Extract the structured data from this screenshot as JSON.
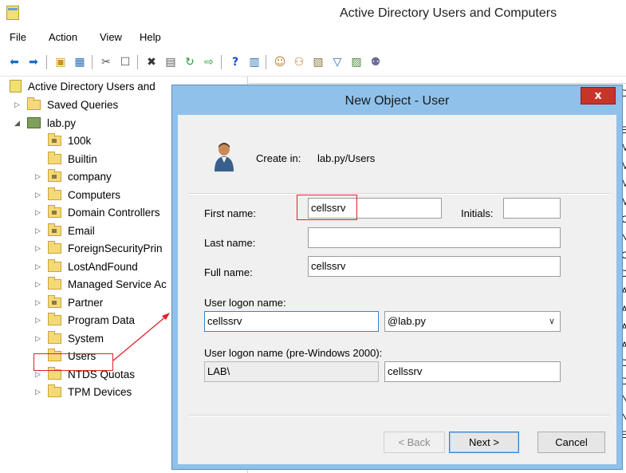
{
  "window": {
    "title": "Active Directory Users and Computers"
  },
  "menu": [
    "File",
    "Action",
    "View",
    "Help"
  ],
  "toolbar_icons": [
    "back-arrow-icon",
    "forward-arrow-icon",
    "up-folder-icon",
    "properties-icon",
    "cut-icon",
    "copy-icon",
    "delete-icon",
    "export-icon",
    "refresh-icon",
    "export-list-icon",
    "help-icon",
    "console-tree-icon",
    "new-user-icon",
    "new-group-icon",
    "new-ou-icon",
    "filter-icon",
    "find-icon",
    "delegate-icon"
  ],
  "tree": {
    "root": "Active Directory Users and",
    "saved_queries": "Saved Queries",
    "domain": "lab.py",
    "items": [
      "100k",
      "Builtin",
      "company",
      "Computers",
      "Domain Controllers",
      "Email",
      "ForeignSecurityPrin",
      "LostAndFound",
      "Managed Service Ac",
      "Partner",
      "Program Data",
      "System",
      "Users",
      "NTDS Quotas",
      "TPM Devices"
    ]
  },
  "background_right": [
    "D",
    "E",
    "M",
    "M",
    "M",
    "M",
    "C",
    "N",
    "C",
    "D",
    "A",
    "A",
    "A",
    "A",
    "D",
    "D",
    "N",
    "N",
    "E"
  ],
  "dialog": {
    "title": "New Object - User",
    "close": "x",
    "create_in_label": "Create in:",
    "create_in_value": "lab.py/Users",
    "first_name_label": "First name:",
    "first_name_value": "cellssrv",
    "initials_label": "Initials:",
    "initials_value": "",
    "last_name_label": "Last name:",
    "last_name_value": "",
    "full_name_label": "Full name:",
    "full_name_value": "cellssrv",
    "logon_label": "User logon name:",
    "logon_value": "cellssrv",
    "domain_suffix": "@lab.py",
    "pre2000_label": "User logon name (pre-Windows 2000):",
    "pre2000_domain": "LAB\\",
    "pre2000_value": "cellssrv",
    "back_button": "< Back",
    "next_button": "Next >",
    "cancel_button": "Cancel"
  },
  "colors": {
    "dialog_frame": "#8fc1ea",
    "close_button": "#c7352a",
    "highlight": "#e0202a"
  }
}
